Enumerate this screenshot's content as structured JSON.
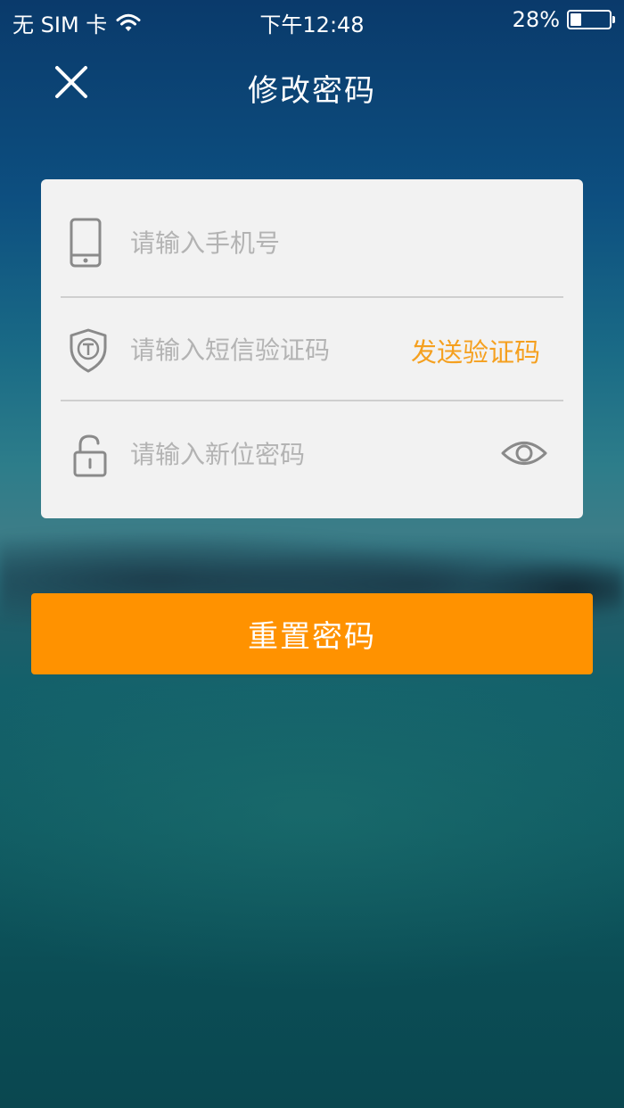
{
  "status_bar": {
    "carrier": "无 SIM 卡",
    "time": "下午12:48",
    "battery_percent": "28%",
    "battery_level": 0.28
  },
  "nav": {
    "title": "修改密码"
  },
  "form": {
    "phone_placeholder": "请输入手机号",
    "code_placeholder": "请输入短信验证码",
    "send_code_label": "发送验证码",
    "password_placeholder": "请输入新位密码"
  },
  "reset_button_label": "重置密码",
  "colors": {
    "accent": "#ff9200",
    "send_code": "#f5a01f",
    "card_bg": "#f2f2f2",
    "placeholder": "#b3b3b3"
  },
  "icons": {
    "close": "close-icon",
    "phone": "phone-icon",
    "shield": "shield-icon",
    "lock": "unlock-icon",
    "eye": "eye-icon",
    "wifi": "wifi-icon",
    "battery": "battery-icon"
  }
}
